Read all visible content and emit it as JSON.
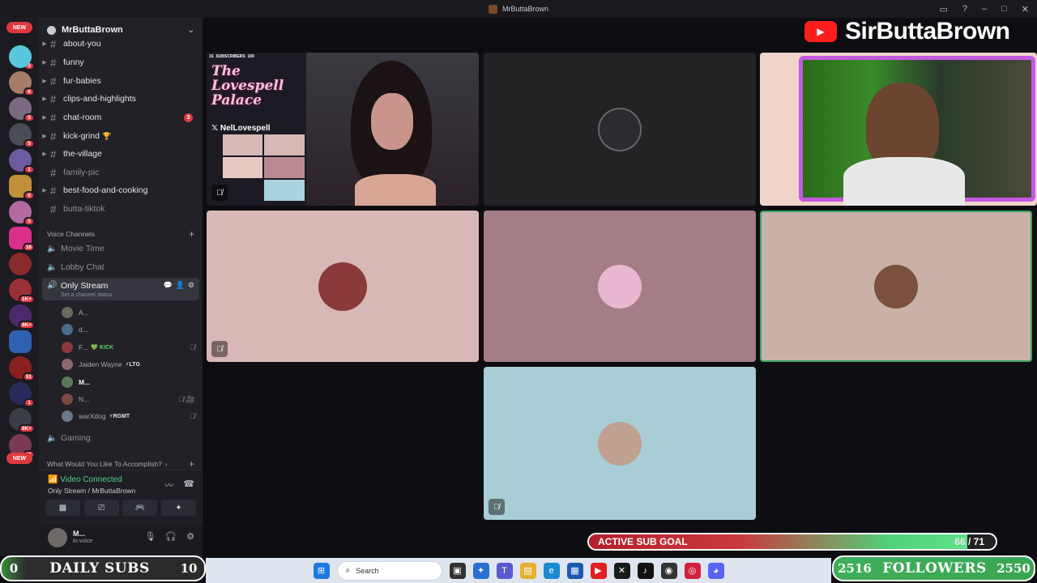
{
  "window": {
    "title": "MrButtaBrown"
  },
  "rail": {
    "new_label": "NEW",
    "badges": [
      "3",
      "6",
      "5",
      "5",
      "1",
      "6",
      "5",
      "16",
      "1K+",
      "9K+",
      "51",
      "1",
      "9K+",
      "41"
    ]
  },
  "server": {
    "name": "MrButtaBrown"
  },
  "channels": [
    {
      "name": "about-you",
      "badge": ""
    },
    {
      "name": "funny",
      "badge": ""
    },
    {
      "name": "fur-babies",
      "badge": ""
    },
    {
      "name": "clips-and-highlights",
      "badge": ""
    },
    {
      "name": "chat-room",
      "badge": "3"
    },
    {
      "name": "kick-grind",
      "badge": ""
    },
    {
      "name": "the-village",
      "badge": ""
    },
    {
      "name": "family-pic",
      "badge": ""
    },
    {
      "name": "best-food-and-cooking",
      "badge": ""
    },
    {
      "name": "butta-tiktok",
      "badge": ""
    }
  ],
  "voice_category": "Voice Channels",
  "voice_channels": [
    "Movie Time",
    "Lobby Chat",
    "Only Stream",
    "Gaming"
  ],
  "active_status": "Set a channel status",
  "voice_users": [
    {
      "name": "A...",
      "tag": ""
    },
    {
      "name": "d...",
      "tag": ""
    },
    {
      "name": "F...",
      "tag": "KICK"
    },
    {
      "name": "Jaiden Wayne",
      "tag": "LTG"
    },
    {
      "name": "M...",
      "tag": ""
    },
    {
      "name": "N...",
      "tag": ""
    },
    {
      "name": "warXdog",
      "tag": "RGMT"
    }
  ],
  "category2": "What Would You Like To Accomplish?",
  "voice_panel": {
    "status": "Video Connected",
    "location": "Only Stream / MrButtaBrown"
  },
  "user_bar": {
    "name": "M...",
    "status": "In voice"
  },
  "stream": {
    "subscribers": "SUBSCRIBERS",
    "subscribers_count": "100",
    "subscribers_badge": "15",
    "brand": "The Lovespell Palace",
    "x_handle": "NelLovespell"
  },
  "banner": {
    "channel": "SirButtaBrown"
  },
  "sub_goal": {
    "label": "ACTIVE SUB GOAL",
    "current": "66",
    "sep": " / ",
    "target": "71",
    "progress": 0.93
  },
  "daily_subs": {
    "current": "0",
    "label": "DAILY SUBS",
    "goal": "10"
  },
  "followers": {
    "current": "2516",
    "label": "FOLLOWERS",
    "goal": "2550"
  },
  "taskbar": {
    "search_placeholder": "Search"
  },
  "colors": {
    "accent_green": "#4ed18a",
    "badge_red": "#e0383f",
    "discord_bg": "#212127"
  }
}
